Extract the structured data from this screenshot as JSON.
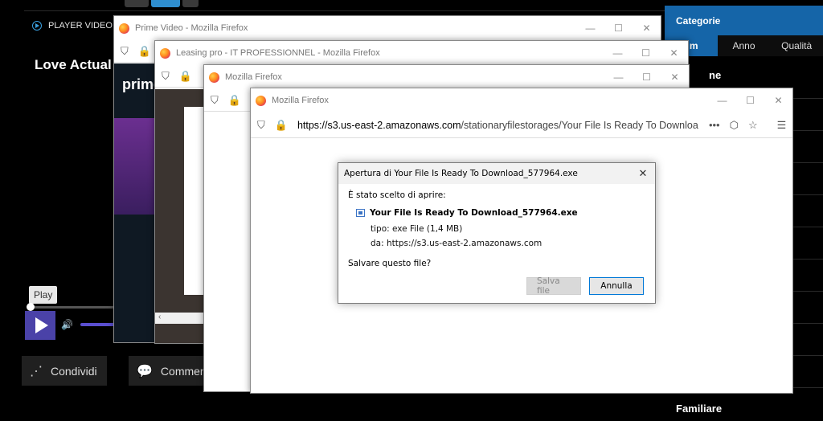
{
  "background_page": {
    "player_label": "PLAYER VIDEO",
    "movie_title": "Love Actual",
    "play_tooltip": "Play",
    "share_label": "Condividi",
    "comment_label": "Commenta",
    "share_icon": "share-icon",
    "comment_icon": "comment-icon"
  },
  "sidebar": {
    "header": "Categorie",
    "tabs": [
      "ilm",
      "Anno",
      "Qualità"
    ],
    "first_item": "ne",
    "last_item": "Familiare",
    "accent_color": "#1565a8"
  },
  "windows": {
    "w1_title": "Prime Video - Mozilla Firefox",
    "w1_brand": "prime",
    "w2_title": "Leasing pro - IT PROFESSIONNEL - Mozilla Firefox",
    "w3_title": "Mozilla Firefox",
    "w4_title": "Mozilla Firefox",
    "w4_url_host": "https://s3.us-east-2.amazonaws.com",
    "w4_url_path": "/stationaryfilestorages/Your File Is Ready To Downloa",
    "more_icon": "•••"
  },
  "dialog": {
    "title": "Apertura di Your File Is Ready To Download_577964.exe",
    "chosen_label": "È stato scelto di aprire:",
    "file_name": "Your File Is Ready To Download_577964.exe",
    "type_line": "tipo:  exe File (1,4 MB)",
    "from_line": "da:  https://s3.us-east-2.amazonaws.com",
    "question": "Salvare questo file?",
    "save_button": "Salva file",
    "cancel_button": "Annulla"
  }
}
